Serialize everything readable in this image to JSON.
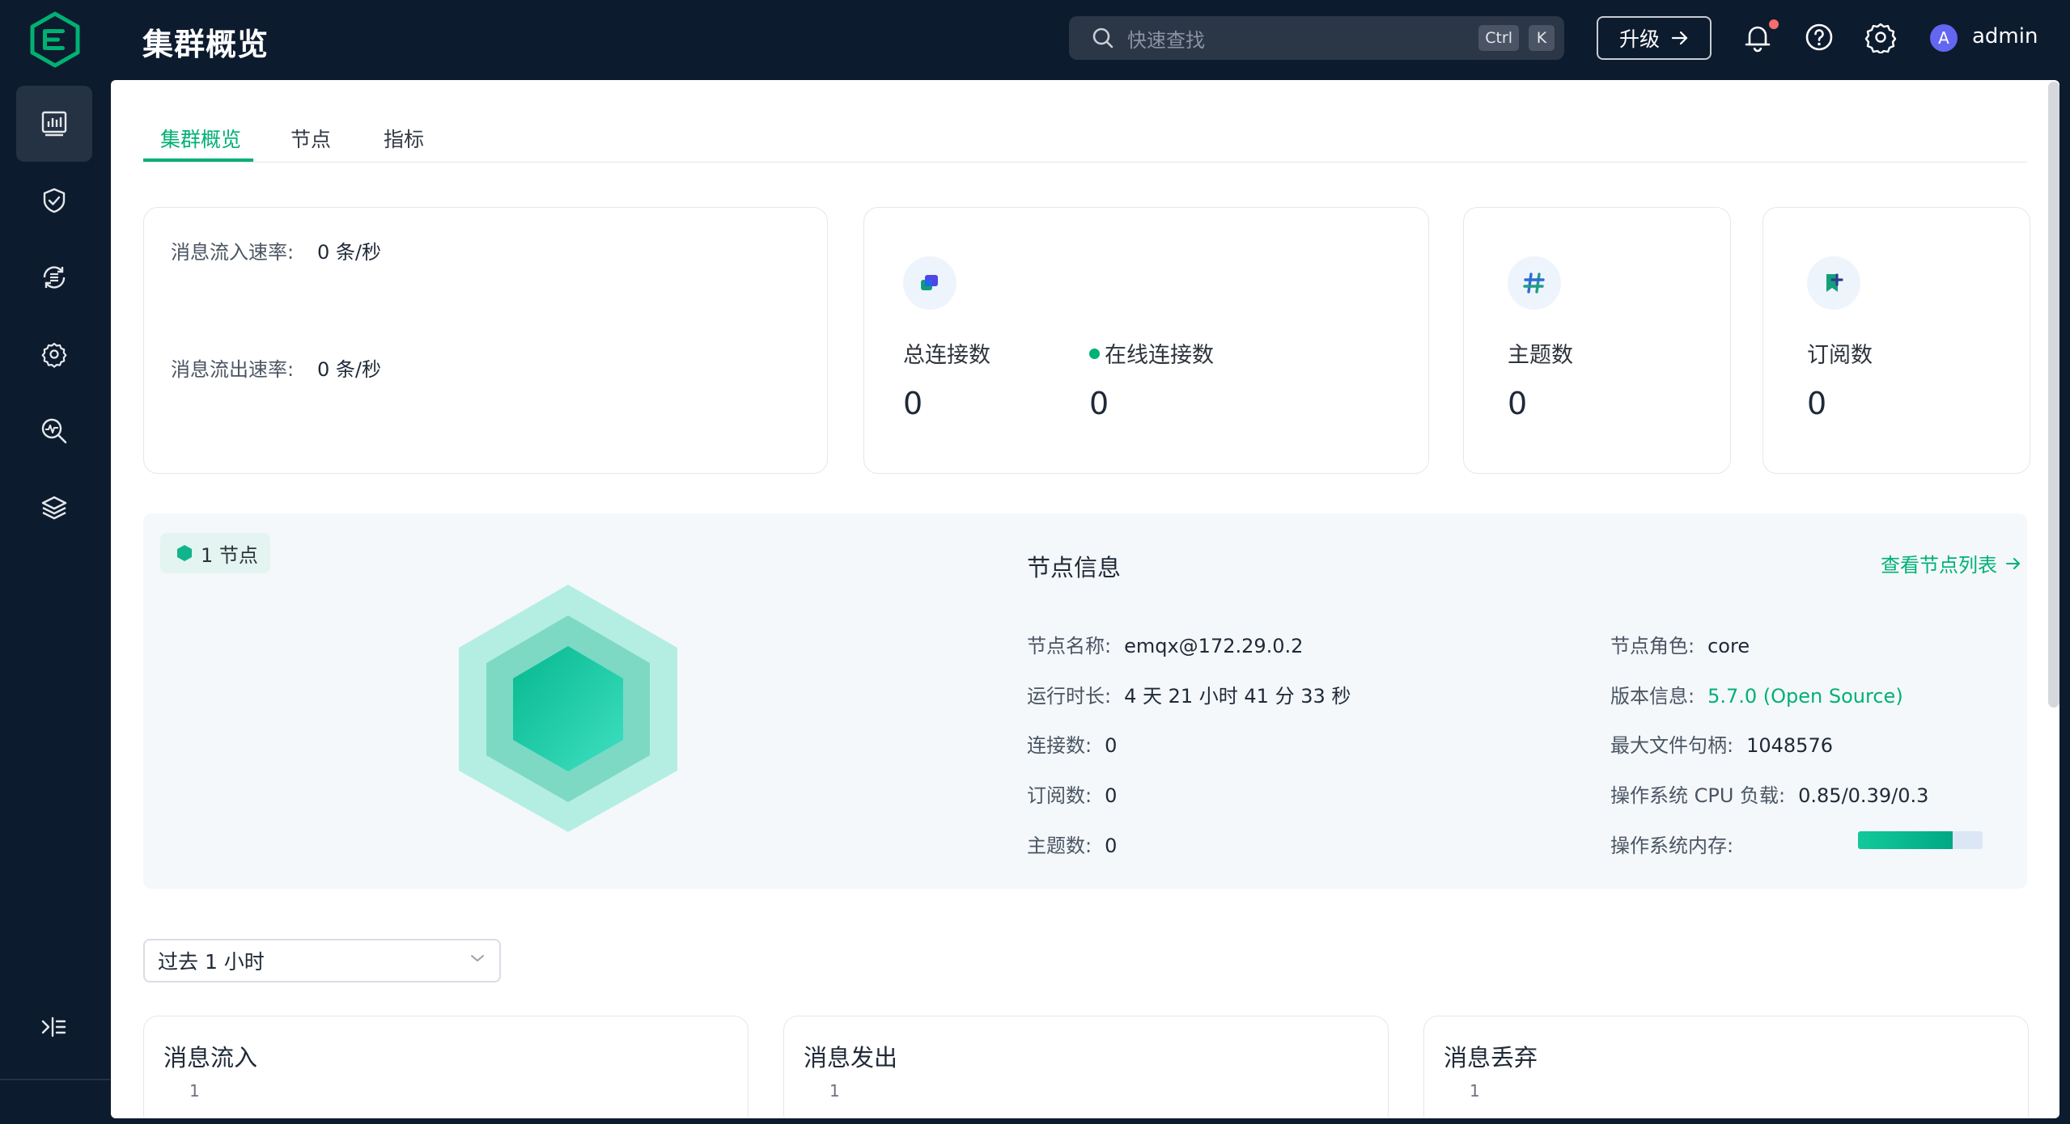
{
  "header": {
    "title": "集群概览",
    "search_placeholder": "快速查找",
    "shortcut_keys": [
      "Ctrl",
      "K"
    ],
    "upgrade_label": "升级",
    "avatar_letter": "A",
    "username": "admin"
  },
  "sidebar": {
    "items": [
      {
        "icon": "dashboard-icon",
        "active": true
      },
      {
        "icon": "shield-icon",
        "active": false
      },
      {
        "icon": "integration-icon",
        "active": false
      },
      {
        "icon": "management-icon",
        "active": false
      },
      {
        "icon": "diagnose-icon",
        "active": false
      },
      {
        "icon": "layers-icon",
        "active": false
      }
    ],
    "collapse_icon": "collapse-icon"
  },
  "tabs": [
    "集群概览",
    "节点",
    "指标"
  ],
  "rates": {
    "in_label": "消息流入速率:",
    "in_value": "0 条/秒",
    "out_label": "消息流出速率:",
    "out_value": "0 条/秒"
  },
  "stats": {
    "total_connections_label": "总连接数",
    "total_connections_value": "0",
    "online_connections_label": "在线连接数",
    "online_connections_value": "0",
    "topics_label": "主题数",
    "topics_value": "0",
    "subscriptions_label": "订阅数",
    "subscriptions_value": "0"
  },
  "node_section": {
    "node_count": "1 节点",
    "info_title": "节点信息",
    "view_list_link": "查看节点列表",
    "left_fields": [
      {
        "label": "节点名称:",
        "value": "emqx@172.29.0.2"
      },
      {
        "label": "运行时长:",
        "value": "4 天 21 小时 41 分 33 秒"
      },
      {
        "label": "连接数:",
        "value": "0"
      },
      {
        "label": "订阅数:",
        "value": "0"
      },
      {
        "label": "主题数:",
        "value": "0"
      }
    ],
    "right_fields": [
      {
        "label": "节点角色:",
        "value": "core"
      },
      {
        "label": "版本信息:",
        "value": "5.7.0 (Open Source)"
      },
      {
        "label": "最大文件句柄:",
        "value": "1048576"
      },
      {
        "label": "操作系统 CPU 负载:",
        "value": "0.85/0.39/0.3"
      },
      {
        "label": "操作系统内存:",
        "value": ""
      }
    ],
    "memory_usage_fraction": 0.76
  },
  "time_range": {
    "selected": "过去 1 小时"
  },
  "charts": [
    {
      "title": "消息流入",
      "top_tick": "1"
    },
    {
      "title": "消息发出",
      "top_tick": "1"
    },
    {
      "title": "消息丢弃",
      "top_tick": "1"
    }
  ],
  "colors": {
    "brand_green": "#00b173",
    "header_bg": "#0d1b2e",
    "notification_dot": "#f56c6c",
    "avatar_bg": "#6366f1"
  }
}
